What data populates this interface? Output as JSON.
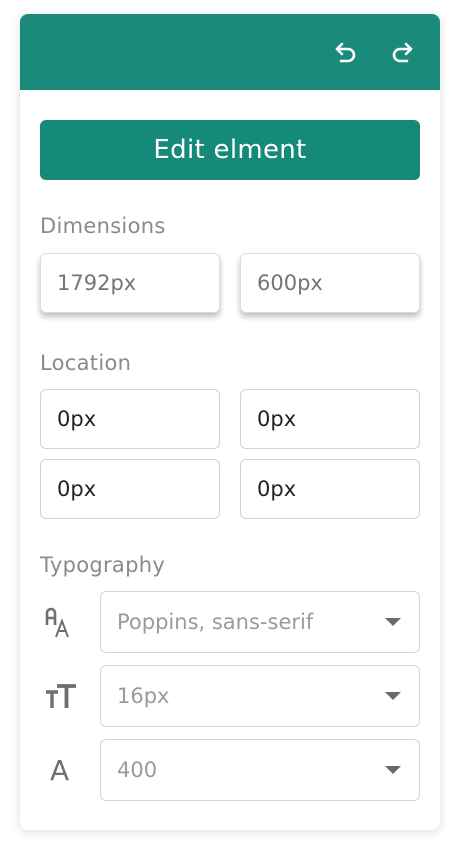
{
  "header": {
    "undo_icon": "undo-icon",
    "redo_icon": "redo-icon",
    "accent": "#1a8a7a"
  },
  "actions": {
    "edit_label": "Edit elment"
  },
  "dimensions": {
    "label": "Dimensions",
    "width_placeholder": "1792px",
    "height_placeholder": "600px"
  },
  "location": {
    "label": "Location",
    "values": [
      "0px",
      "0px",
      "0px",
      "0px"
    ]
  },
  "typography": {
    "label": "Typography",
    "font_family": {
      "icon": "font-family-icon",
      "value": "Poppins, sans-serif"
    },
    "font_size": {
      "icon": "font-size-icon",
      "value": "16px"
    },
    "font_weight": {
      "icon": "font-weight-icon",
      "glyph": "A",
      "value": "400"
    }
  }
}
